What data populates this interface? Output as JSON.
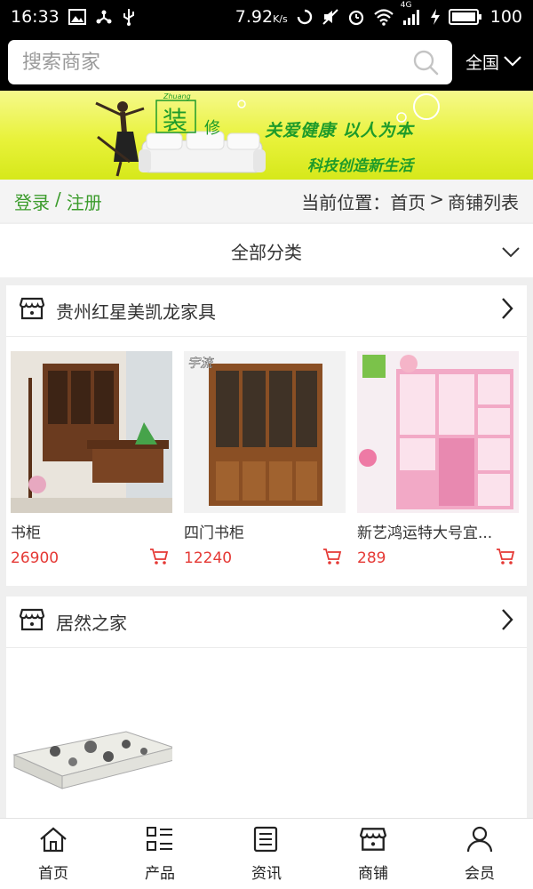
{
  "status_bar": {
    "time": "16:33",
    "network_speed": "7.92",
    "speed_unit": "K/s",
    "signal_tag": "4G",
    "battery": "100"
  },
  "search": {
    "placeholder": "搜索商家",
    "region_label": "全国"
  },
  "banner": {
    "logo_char": "装",
    "logo_char2": "修",
    "logo_small": "Zhuang",
    "slogan_line1": "关爱健康  以人为本",
    "slogan_line2": "科技创造新生活"
  },
  "breadcrumb": {
    "login": "登录",
    "separator": "/",
    "register": "注册",
    "location_prefix": "当前位置：",
    "home": "首页",
    "arrow": ">",
    "current": "商铺列表"
  },
  "category": {
    "label": "全部分类"
  },
  "stores": [
    {
      "name": "贵州红星美凯龙家具",
      "products": [
        {
          "name": "书柜",
          "price": "26900"
        },
        {
          "name": "四门书柜",
          "price": "12240"
        },
        {
          "name": "新艺鸿运特大号宜...",
          "price": "289"
        }
      ]
    },
    {
      "name": "居然之家",
      "products": []
    }
  ],
  "tabs": [
    {
      "label": "首页",
      "icon": "home-icon"
    },
    {
      "label": "产品",
      "icon": "products-icon"
    },
    {
      "label": "资讯",
      "icon": "news-icon"
    },
    {
      "label": "商铺",
      "icon": "store-icon"
    },
    {
      "label": "会员",
      "icon": "member-icon"
    }
  ],
  "colors": {
    "accent_green": "#3b9b2b",
    "price_red": "#e53935",
    "banner_yellow": "#e8f23a"
  }
}
